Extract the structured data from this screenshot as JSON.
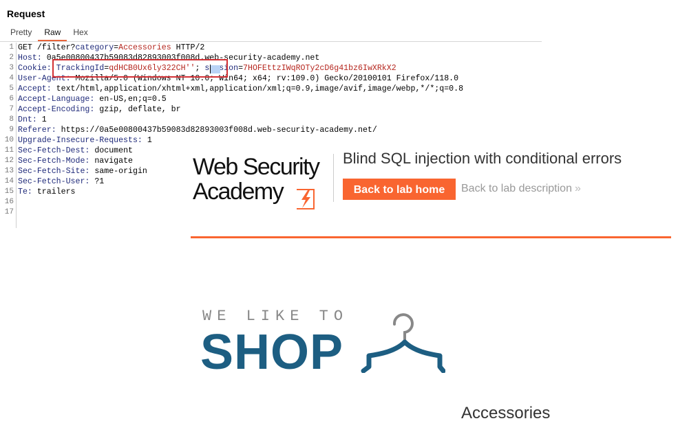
{
  "request_panel": {
    "title": "Request",
    "tabs": [
      {
        "label": "Pretty",
        "active": false
      },
      {
        "label": "Raw",
        "active": true
      },
      {
        "label": "Hex",
        "active": false
      }
    ],
    "line_numbers": [
      "1",
      "2",
      "3",
      "4",
      "5",
      "6",
      "7",
      "8",
      "9",
      "10",
      "11",
      "12",
      "13",
      "14",
      "15",
      "16",
      "17"
    ],
    "lines": {
      "l1": {
        "method": "GET /filter?",
        "param_name": "category",
        "eq": "=",
        "param_value": "Accessories",
        "rest": " HTTP/2"
      },
      "l2": {
        "key": "Host:",
        "value": " 0a5e00800437b59083d82893003f008d.web-security-academy.net"
      },
      "l3": {
        "key": "Cookie:",
        "space": " ",
        "c1_name": "TrackingId",
        "eq1": "=",
        "c1_value": "qdHCB0Ux6ly322CH''",
        "sep": "; ",
        "c2_name": "session",
        "eq2": "=",
        "c2_value": "7HOFEttzIWqROTy2cD6g41bz6IwXRkX2"
      },
      "l4": {
        "key": "User-Agent:",
        "value": " Mozilla/5.0 (Windows NT 10.0; Win64; x64; rv:109.0) Gecko/20100101 Firefox/118.0"
      },
      "l5": {
        "key": "Accept:",
        "value": " text/html,application/xhtml+xml,application/xml;q=0.9,image/avif,image/webp,*/*;q=0.8"
      },
      "l6": {
        "key": "Accept-Language:",
        "value": " en-US,en;q=0.5"
      },
      "l7": {
        "key": "Accept-Encoding:",
        "value": " gzip, deflate, br"
      },
      "l8": {
        "key": "Dnt:",
        "value": " 1"
      },
      "l9": {
        "key": "Referer:",
        "value": " https://0a5e00800437b59083d82893003f008d.web-security-academy.net/"
      },
      "l10": {
        "key": "Upgrade-Insecure-Requests:",
        "value": " 1"
      },
      "l11": {
        "key": "Sec-Fetch-Dest:",
        "value": " document"
      },
      "l12": {
        "key": "Sec-Fetch-Mode:",
        "value": " navigate"
      },
      "l13": {
        "key": "Sec-Fetch-Site:",
        "value": " same-origin"
      },
      "l14": {
        "key": "Sec-Fetch-User:",
        "value": " ?1"
      },
      "l15": {
        "key": "Te:",
        "value": " trailers"
      }
    }
  },
  "lab_header": {
    "logo_line1": "Web Security",
    "logo_line2": "Academy",
    "title": "Blind SQL injection with conditional errors",
    "back_home_label": "Back to lab home",
    "back_desc_label": "Back to lab description",
    "chevron": "»",
    "accent_color": "#f96530"
  },
  "shop": {
    "tagline": "WE LIKE TO",
    "word": "SHOP",
    "brand_color": "#1d5e82",
    "icon": "hanger-icon",
    "category_heading": "Accessories"
  }
}
